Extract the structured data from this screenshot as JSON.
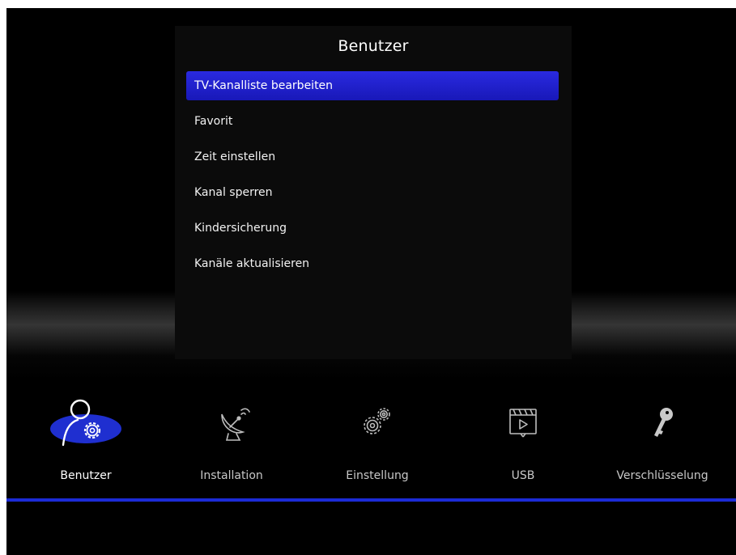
{
  "panel": {
    "title": "Benutzer",
    "items": [
      {
        "label": "TV-Kanalliste bearbeiten",
        "selected": true
      },
      {
        "label": "Favorit",
        "selected": false
      },
      {
        "label": "Zeit einstellen",
        "selected": false
      },
      {
        "label": "Kanal sperren",
        "selected": false
      },
      {
        "label": "Kindersicherung",
        "selected": false
      },
      {
        "label": "Kanäle aktualisieren",
        "selected": false
      }
    ]
  },
  "iconbar": {
    "items": [
      {
        "label": "Benutzer",
        "icon": "user-gear-icon",
        "active": true
      },
      {
        "label": "Installation",
        "icon": "satellite-dish-icon",
        "active": false
      },
      {
        "label": "Einstellung",
        "icon": "gears-icon",
        "active": false
      },
      {
        "label": "USB",
        "icon": "media-player-icon",
        "active": false
      },
      {
        "label": "Verschlüsselung",
        "icon": "key-icon",
        "active": false
      }
    ]
  },
  "colors": {
    "selection": "#2222cc",
    "accent_line": "#1c2bd6",
    "active_icon_bg": "#1f2fd0"
  }
}
